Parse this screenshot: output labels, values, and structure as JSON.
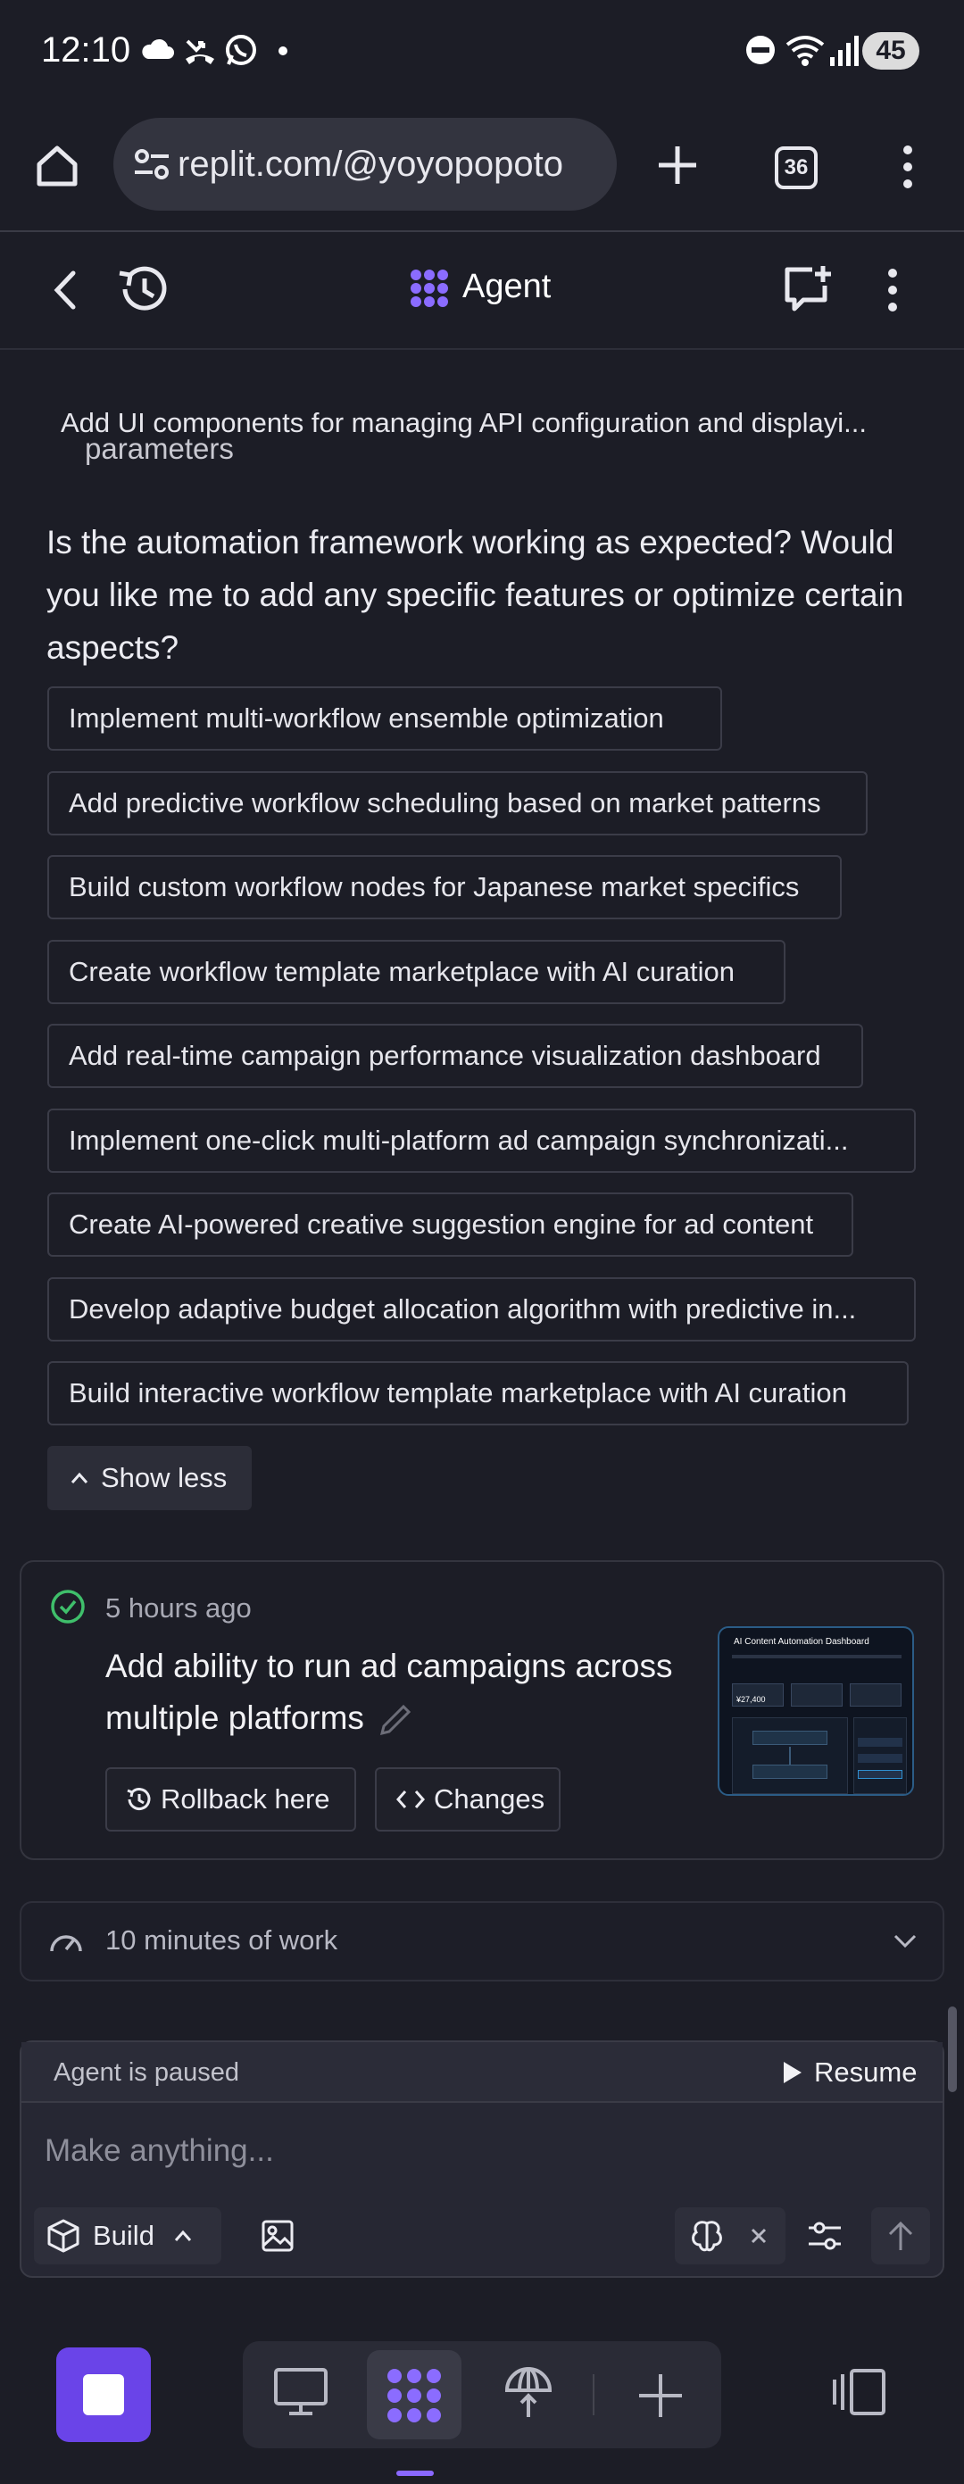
{
  "status_bar": {
    "time": "12:10",
    "battery": "45",
    "icons": [
      "cloud-icon",
      "missed-call-icon",
      "whatsapp-icon",
      "notification-dot-icon",
      "dnd-icon",
      "wifi-icon",
      "signal-icon"
    ]
  },
  "browser": {
    "url": "replit.com/@yoyopopoto",
    "tab_count": "36"
  },
  "agent_header": {
    "title": "Agent",
    "accent": "#8b6cff"
  },
  "conversation": {
    "previous_item": "Add UI components for managing API configuration and displayi...",
    "previous_item_tail": "parameters",
    "question": "Is the automation framework working as expected? Would you like me to add any specific features or optimize certain aspects?",
    "suggestions": [
      "Implement multi-workflow ensemble optimization",
      "Add predictive workflow scheduling based on market patterns",
      "Build custom workflow nodes for Japanese market specifics",
      "Create workflow template marketplace with AI curation",
      "Add real-time campaign performance visualization dashboard",
      "Implement one-click multi-platform ad campaign synchronizati...",
      "Create AI-powered creative suggestion engine for ad content",
      "Develop adaptive budget allocation algorithm with predictive in...",
      "Build interactive workflow template marketplace with AI curation"
    ],
    "show_less": "Show less"
  },
  "checkpoint": {
    "time": "5 hours ago",
    "title": "Add ability to run ad campaigns across multiple platforms",
    "rollback_label": "Rollback here",
    "changes_label": "Changes",
    "status_color": "#3fbf6b",
    "thumbnail": {
      "title": "AI Content Automation Dashboard",
      "stat": "¥27,400"
    }
  },
  "work": {
    "label": "10 minutes of work"
  },
  "composer": {
    "status": "Agent is paused",
    "resume_label": "Resume",
    "placeholder": "Make anything...",
    "mode_label": "Build"
  },
  "nav": {
    "stop_color": "#6a44e8"
  }
}
